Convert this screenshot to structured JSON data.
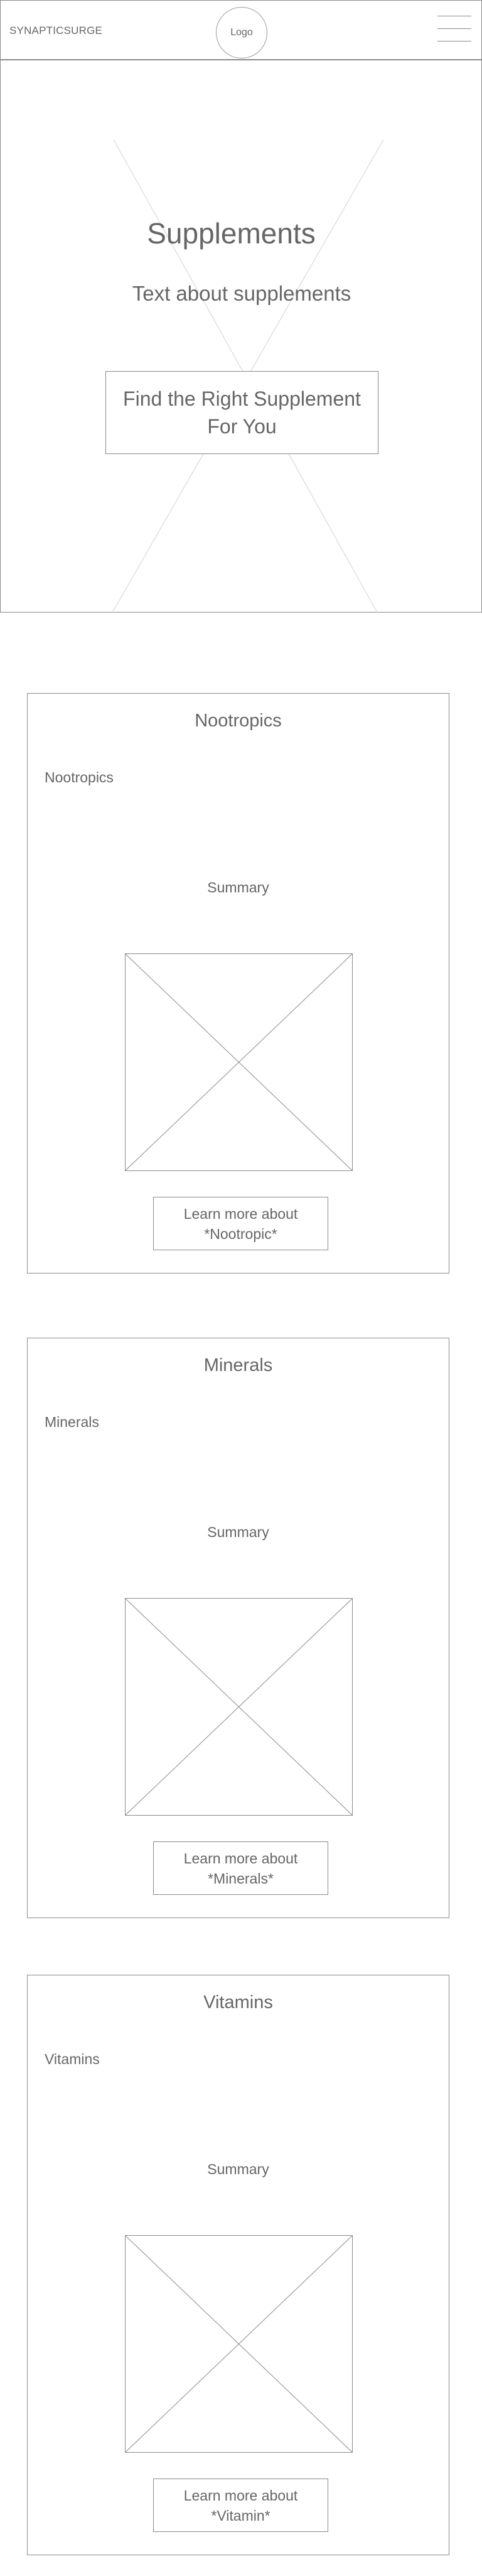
{
  "header": {
    "brand": "SYNAPTICSURGE",
    "logo_label": "Logo",
    "menu_icon": "hamburger-menu-icon"
  },
  "hero": {
    "title": "Supplements",
    "subtitle": "Text about supplements",
    "button_label": "Find the Right Supplement For You"
  },
  "sections": [
    {
      "title": "Nootropics",
      "dropdown_label": "Nootropics",
      "dropdown_icon": "triangle-down-icon",
      "summary": "Summary",
      "image_placeholder": "image-placeholder-icon",
      "button_line1": "Learn more about",
      "button_line2": "*Nootropic*"
    },
    {
      "title": "Minerals",
      "dropdown_label": "Minerals",
      "dropdown_icon": "triangle-down-icon",
      "summary": "Summary",
      "image_placeholder": "image-placeholder-icon",
      "button_line1": "Learn more about",
      "button_line2": "*Minerals*"
    },
    {
      "title": "Vitamins",
      "dropdown_label": "Vitamins",
      "dropdown_icon": "triangle-down-icon",
      "summary": "Summary",
      "image_placeholder": "image-placeholder-icon",
      "button_line1": "Learn more about",
      "button_line2": "*Vitamin*"
    }
  ]
}
